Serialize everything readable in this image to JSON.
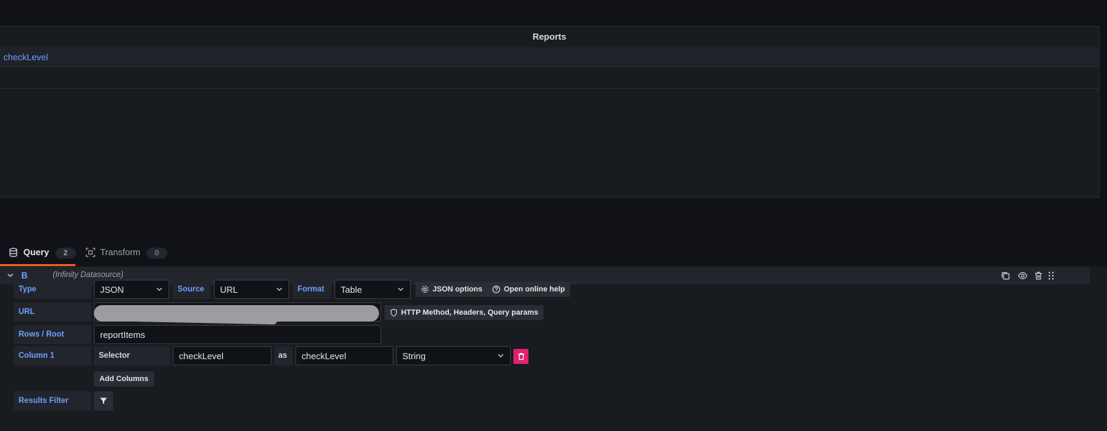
{
  "panel": {
    "title": "Reports",
    "rows": [
      "checkLevel"
    ]
  },
  "tabs": [
    {
      "label": "Query",
      "count": "2"
    },
    {
      "label": "Transform",
      "count": "0"
    }
  ],
  "query": {
    "ref_id": "B",
    "datasource": "(Infinity Datasource)",
    "type_label": "Type",
    "type_value": "JSON",
    "source_label": "Source",
    "source_value": "URL",
    "format_label": "Format",
    "format_value": "Table",
    "json_options_label": "JSON options",
    "online_help_label": "Open online help",
    "url_label": "URL",
    "http_button_label": "HTTP Method, Headers, Query params",
    "rows_root_label": "Rows / Root",
    "rows_root_value": "reportItems",
    "column1_label": "Column 1",
    "selector_label": "Selector",
    "selector_value": "checkLevel",
    "as_label": "as",
    "alias_value": "checkLevel",
    "column_type_value": "String",
    "add_columns_label": "Add Columns",
    "results_filter_label": "Results Filter"
  },
  "colors": {
    "accent_blue": "#6e9fff",
    "tab_underline": "#f05a28",
    "delete_button": "#e0226e",
    "background": "#111217",
    "panel_bg": "#181b1f"
  }
}
